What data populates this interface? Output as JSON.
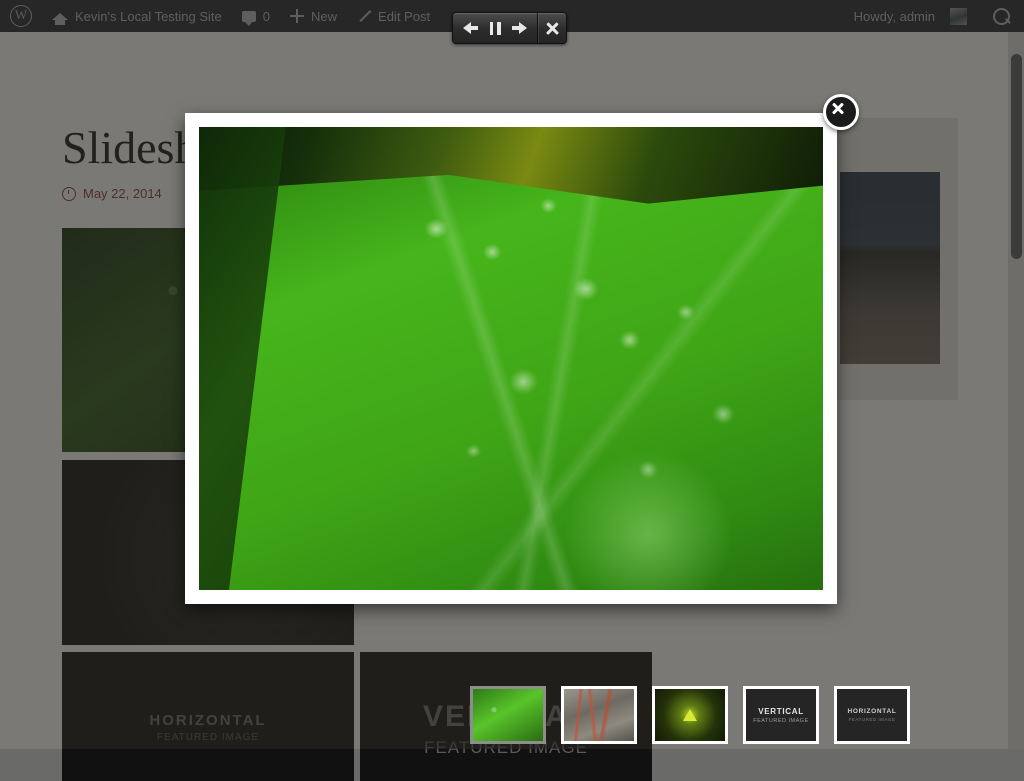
{
  "admin_bar": {
    "wp_logo": "W",
    "site_name": "Kevin's Local Testing Site",
    "comment_count": "0",
    "new_label": "New",
    "edit_label": "Edit Post",
    "howdy": "Howdy, admin",
    "icons": {
      "wordpress": "wordpress-logo-icon",
      "home": "home-icon",
      "comment": "comment-bubble-icon",
      "plus": "plus-icon",
      "pencil": "pencil-icon",
      "avatar": "user-avatar",
      "search": "search-icon"
    },
    "background": "#23282d",
    "text_color": "#b4b9be"
  },
  "slideshow_controls": {
    "previous": "←",
    "pause": "❙❙",
    "next": "→",
    "close": "✕",
    "names": {
      "previous": "slideshow-previous-button",
      "pause": "slideshow-pause-button",
      "next": "slideshow-next-button",
      "close": "slideshow-close-button"
    }
  },
  "post": {
    "title": "Slideshow gallery added",
    "date": "May 22, 2014",
    "category_icon": "folder-icon",
    "date_icon": "clock-icon",
    "meta_color": "#8a3b2e"
  },
  "lightbox": {
    "current_image": "green-leaf-with-water-droplets",
    "close_label": "✕",
    "frame_color": "#ffffff"
  },
  "gallery_background": [
    {
      "name": "leaf-thumbnail-large",
      "type": "photo"
    },
    {
      "name": "dark-photo",
      "type": "photo"
    },
    {
      "name": "horizontal-featured-image",
      "label": "HORIZONTAL",
      "sublabel": "FEATURED IMAGE"
    },
    {
      "name": "vertical-featured-image",
      "label": "VERTICAL",
      "sublabel": "FEATURED IMAGE"
    },
    {
      "name": "palm-building-photo",
      "type": "photo"
    }
  ],
  "thumbnails": [
    {
      "name": "thumb-green-leaf",
      "label": "",
      "sublabel": "",
      "active": true
    },
    {
      "name": "thumb-rock-graffiti",
      "label": "",
      "sublabel": "",
      "active": false
    },
    {
      "name": "thumb-radioactive",
      "label": "",
      "sublabel": "",
      "active": false
    },
    {
      "name": "thumb-vertical-featured",
      "label": "VERTICAL",
      "sublabel": "FEATURED IMAGE",
      "active": false
    },
    {
      "name": "thumb-horizontal-featured",
      "label": "HORIZONTAL",
      "sublabel": "FEATURED IMAGE",
      "active": false
    }
  ],
  "overlay": {
    "color": "rgba(40,38,34,.62)"
  },
  "scrollbar": {
    "thumb_color": "#3b3b39",
    "track_color": "#6f6d6a"
  }
}
